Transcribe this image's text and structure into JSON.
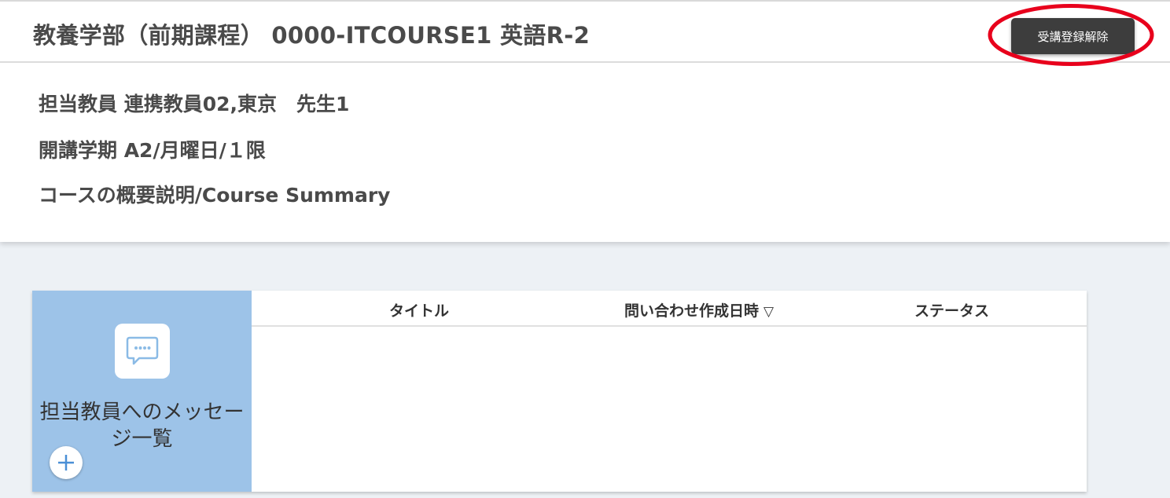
{
  "header": {
    "course_title": "教養学部（前期課程） 0000-ITCOURSE1 英語R-2",
    "unregister_label": "受講登録解除"
  },
  "info": {
    "teacher": "担当教員 連携教員02,東京　先生1",
    "term": "開講学期 A2/月曜日/１限",
    "summary_link": "コースの概要説明/Course Summary"
  },
  "messages": {
    "card_title": "担当教員へのメッセージ一覧",
    "columns": {
      "title": "タイトル",
      "created": "問い合わせ作成日時",
      "sort_indicator": "▽",
      "status": "ステータス"
    },
    "rows": []
  },
  "colors": {
    "unregister_button": "#3d3d3d",
    "highlight_ring": "#e8001c",
    "card_background": "#9dc3e8",
    "page_background": "#edf1f5"
  },
  "icons": {
    "message": "chat-bubble-icon",
    "add": "plus-icon"
  }
}
